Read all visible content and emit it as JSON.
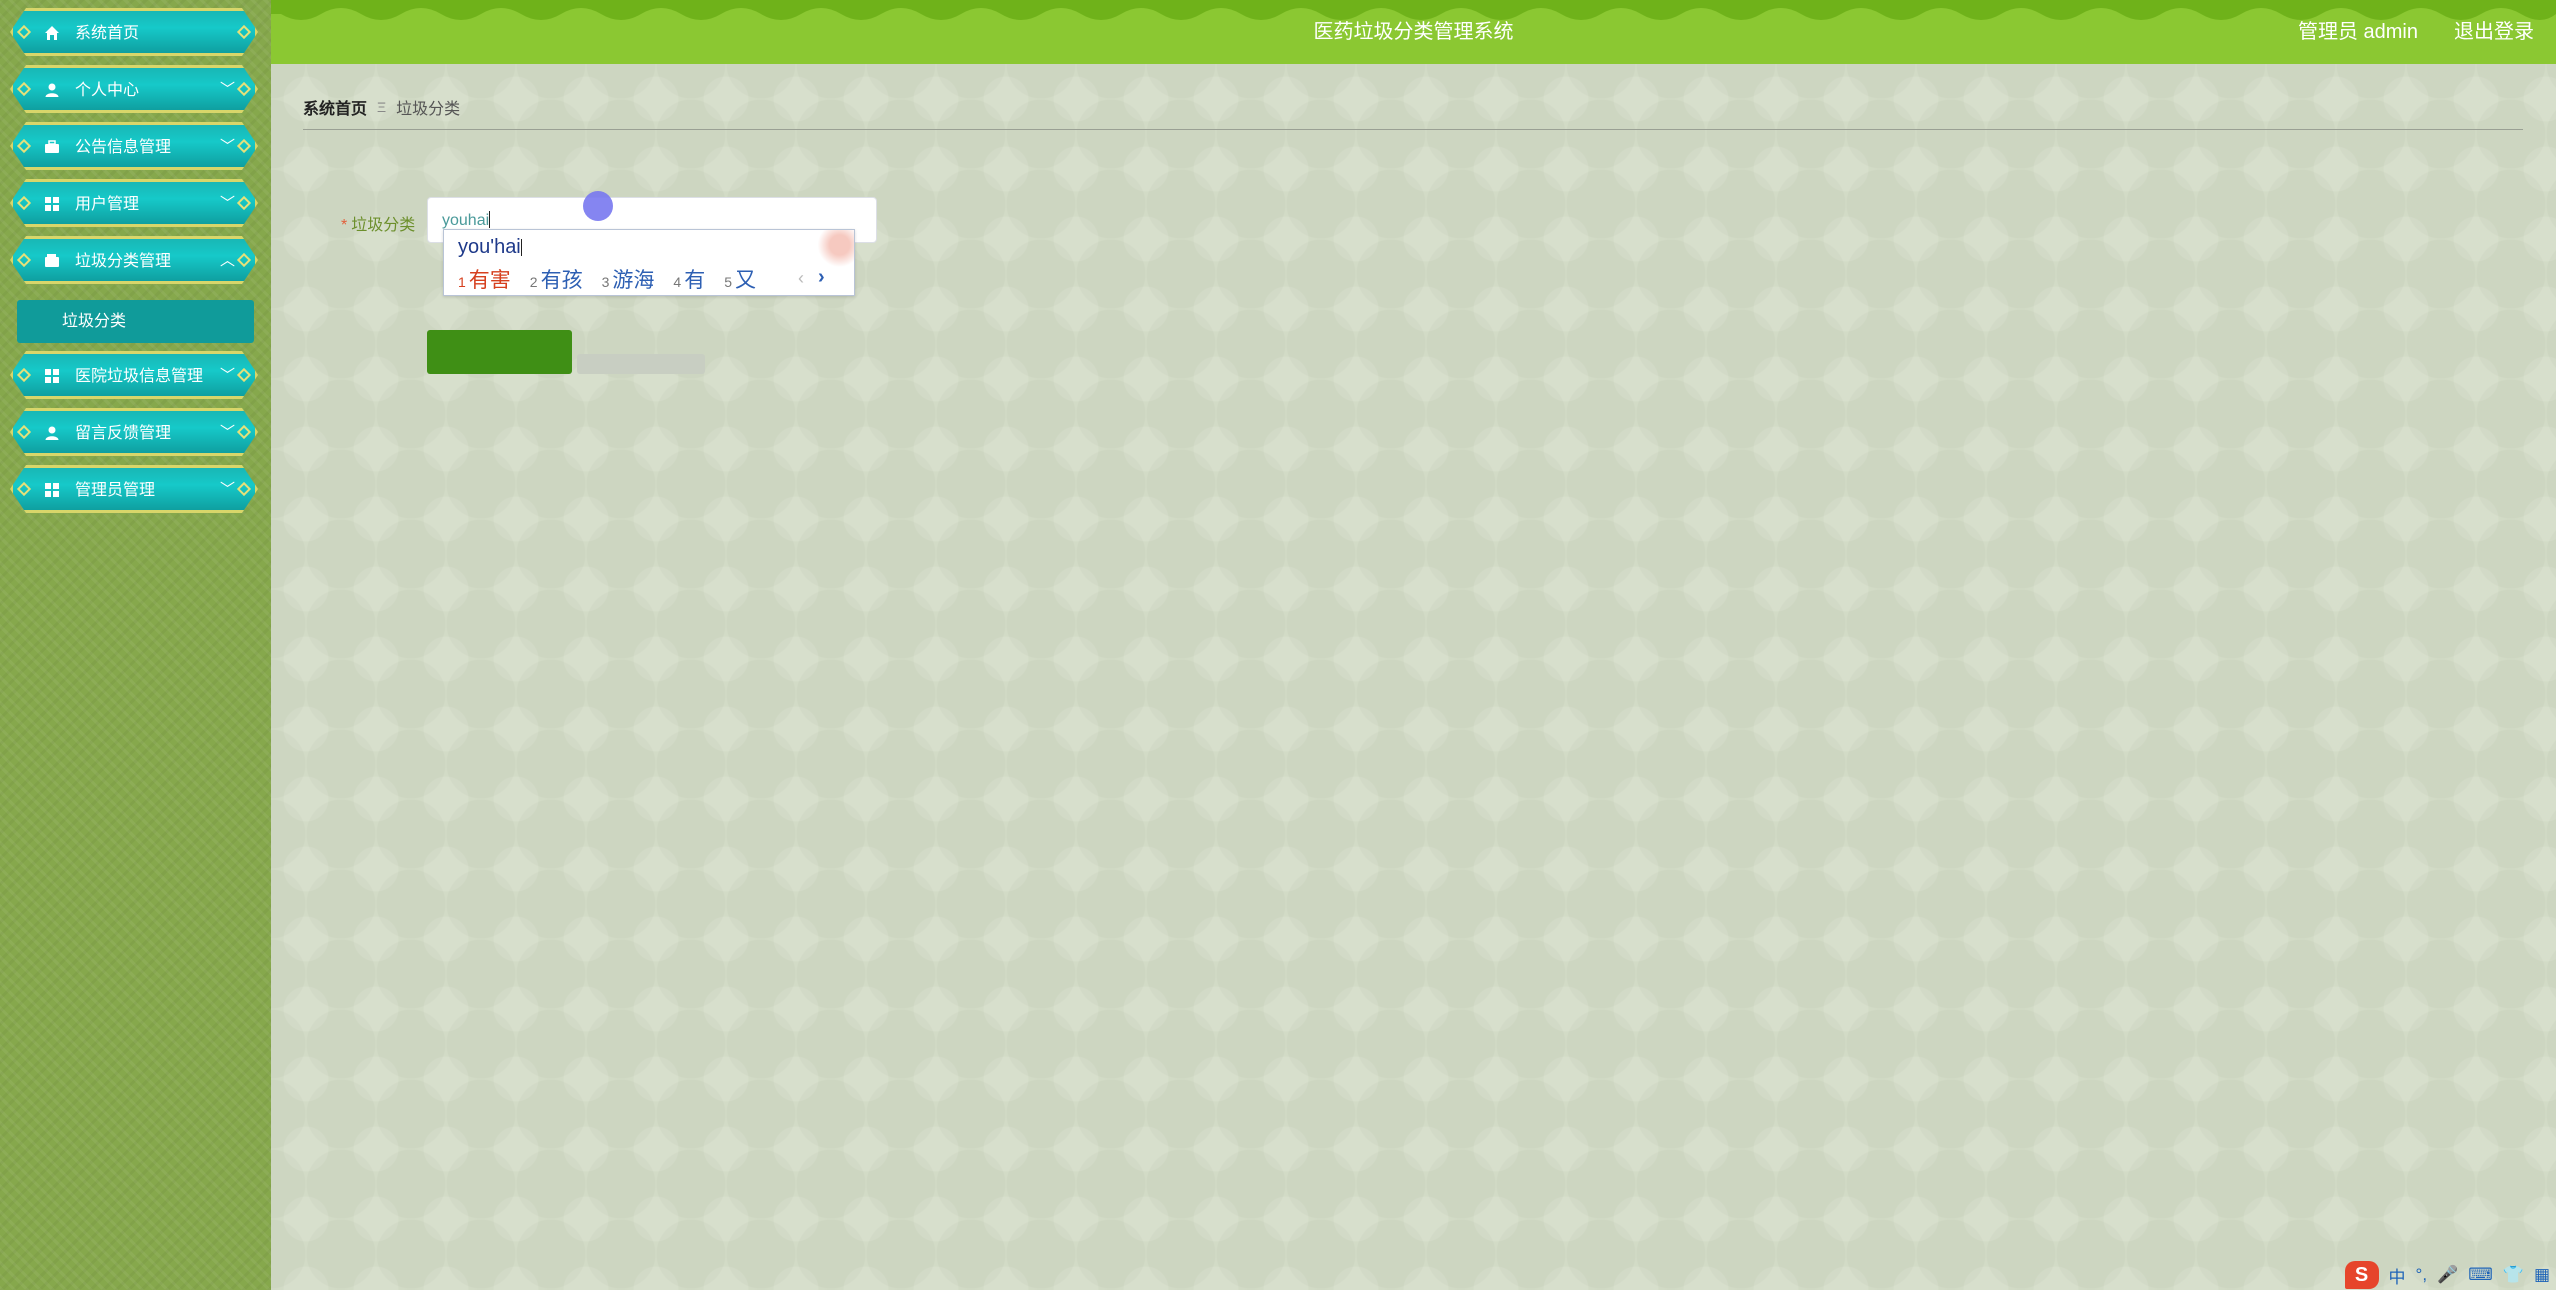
{
  "app": {
    "title": "医药垃圾分类管理系统",
    "user": "管理员 admin",
    "logout": "退出登录"
  },
  "sidebar": {
    "items": [
      {
        "label": "系统首页",
        "icon": "home-icon"
      },
      {
        "label": "个人中心",
        "icon": "user-icon"
      },
      {
        "label": "公告信息管理",
        "icon": "briefcase-icon"
      },
      {
        "label": "用户管理",
        "icon": "grid-icon"
      },
      {
        "label": "垃圾分类管理",
        "icon": "wallet-icon"
      },
      {
        "label": "医院垃圾信息管理",
        "icon": "grid-icon"
      },
      {
        "label": "留言反馈管理",
        "icon": "user-icon"
      },
      {
        "label": "管理员管理",
        "icon": "grid-icon"
      }
    ],
    "sub_item": "垃圾分类",
    "colors": {
      "item": "#16c9c9",
      "border": "#d8d66a",
      "sidebar_bg": "#86a84c",
      "sub_item": "#109b9a"
    }
  },
  "breadcrumb": {
    "home": "系统首页",
    "separator": "Ξ",
    "current": "垃圾分类"
  },
  "form": {
    "required_mark": "*",
    "label": "垃圾分类",
    "input_value": "youhai"
  },
  "ime": {
    "composition": "you'hai",
    "candidates": [
      {
        "num": "1",
        "text": "有害"
      },
      {
        "num": "2",
        "text": "有孩"
      },
      {
        "num": "3",
        "text": "游海"
      },
      {
        "num": "4",
        "text": "有"
      },
      {
        "num": "5",
        "text": "又"
      }
    ],
    "prev": "‹",
    "next": "›"
  },
  "tray": {
    "logo": "S",
    "items": [
      "中",
      "°,",
      "🎤",
      "⌨",
      "👕",
      "▦"
    ]
  },
  "colors": {
    "header": "#8bc832",
    "main_bg": "#d2dbc6",
    "submit": "#3f8f15",
    "label": "#6c8f2b"
  }
}
